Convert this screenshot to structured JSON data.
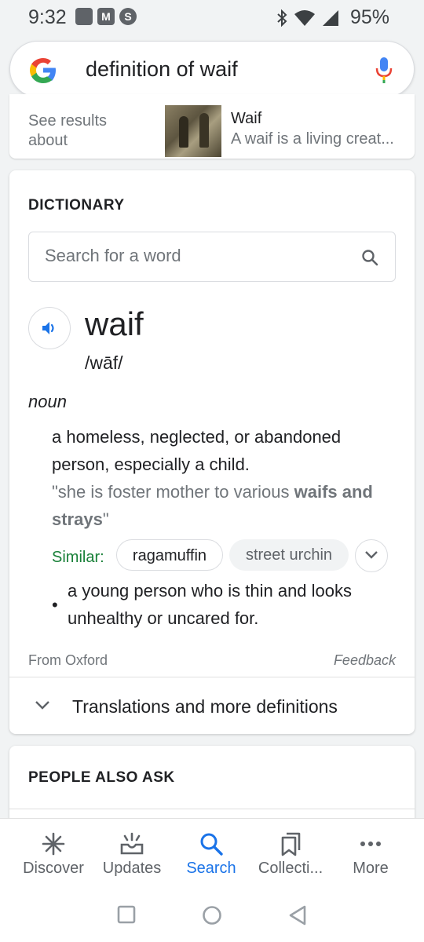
{
  "status_bar": {
    "time": "9:32",
    "battery": "95%",
    "icons": [
      "notification-square-icon",
      "gmail-icon",
      "s-app-icon",
      "bluetooth-icon",
      "wifi-icon",
      "cell-signal-icon"
    ]
  },
  "search": {
    "query": "definition of waif",
    "icons": [
      "google-g-logo",
      "mic-icon"
    ]
  },
  "top_card": {
    "see_results": "See results about",
    "title": "Waif",
    "snippet": "A waif is a living creat..."
  },
  "dictionary": {
    "heading": "DICTIONARY",
    "search_placeholder": "Search for a word",
    "word": "waif",
    "phonetic": "/wāf/",
    "part_of_speech": "noun",
    "definition_1": "a homeless, neglected, or abandoned person, especially a child.",
    "example_prefix": "\"she is foster mother to various ",
    "example_bold": "waifs and strays",
    "example_suffix": "\"",
    "similar_label": "Similar:",
    "similar": [
      "ragamuffin",
      "street urchin"
    ],
    "bullet": "•",
    "definition_2": "a young person who is thin and looks unhealthy or uncared for.",
    "source": "From Oxford",
    "feedback": "Feedback",
    "more_definitions": "Translations and more definitions"
  },
  "people_also_ask": {
    "heading": "PEOPLE ALSO ASK"
  },
  "bottom_nav": {
    "items": [
      {
        "label": "Discover",
        "icon": "asterisk-icon",
        "active": false
      },
      {
        "label": "Updates",
        "icon": "inbox-updates-icon",
        "active": false
      },
      {
        "label": "Search",
        "icon": "search-icon",
        "active": true
      },
      {
        "label": "Collecti...",
        "icon": "bookmarks-icon",
        "active": false
      },
      {
        "label": "More",
        "icon": "more-horiz-icon",
        "active": false
      }
    ]
  },
  "colors": {
    "accent_blue": "#1a73e8",
    "similar_green": "#188038",
    "secondary_text": "#70757a",
    "background": "#f1f3f4"
  }
}
